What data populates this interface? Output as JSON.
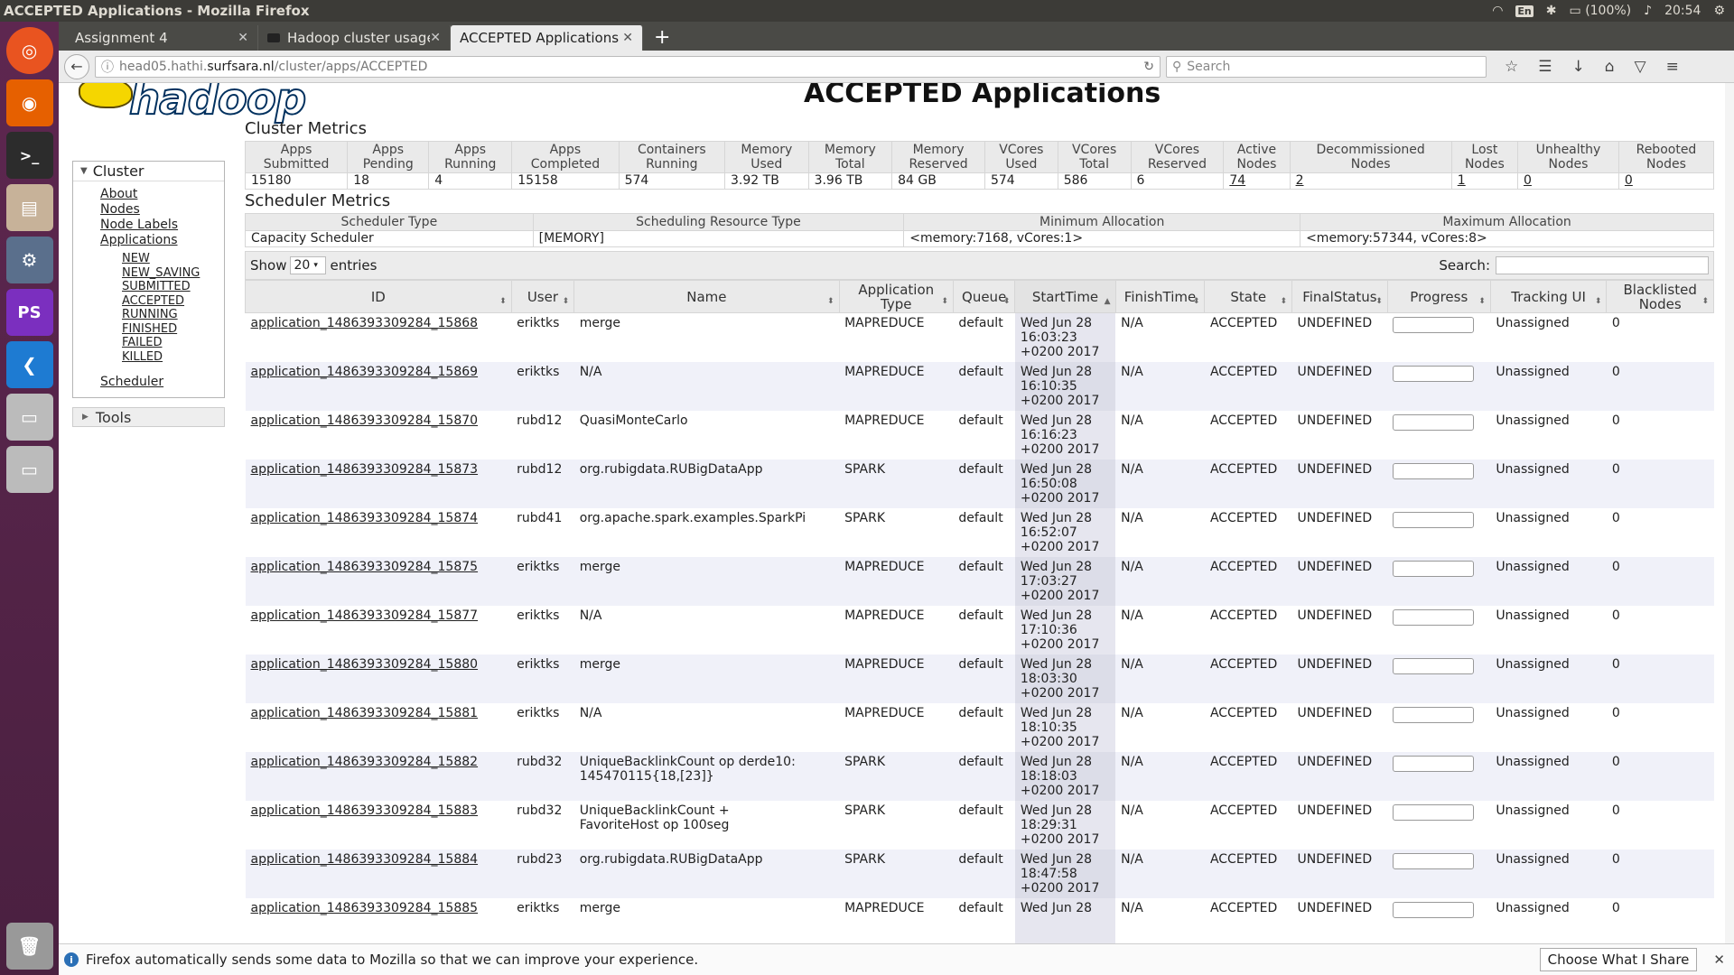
{
  "window_title": "ACCEPTED Applications - Mozilla Firefox",
  "tray": {
    "kbd": "En",
    "battery": "(100%)",
    "time": "20:54"
  },
  "tabs": [
    {
      "label": "Assignment 4"
    },
    {
      "label": "Hadoop cluster usage"
    },
    {
      "label": "ACCEPTED Applications"
    }
  ],
  "url": {
    "prefix": "head05.hathi.",
    "host": "surfsara.nl",
    "path": "/cluster/apps/ACCEPTED"
  },
  "search_placeholder": "Search",
  "page": {
    "logo": "hadoop",
    "title": "ACCEPTED Applications"
  },
  "nav": {
    "cluster": "Cluster",
    "about": "About",
    "nodes": "Nodes",
    "node_labels": "Node Labels",
    "applications": "Applications",
    "states": [
      "NEW",
      "NEW_SAVING",
      "SUBMITTED",
      "ACCEPTED",
      "RUNNING",
      "FINISHED",
      "FAILED",
      "KILLED"
    ],
    "scheduler": "Scheduler",
    "tools": "Tools"
  },
  "cluster_metrics": {
    "title": "Cluster Metrics",
    "headers": [
      [
        "Apps",
        "Submitted"
      ],
      [
        "Apps",
        "Pending"
      ],
      [
        "Apps",
        "Running"
      ],
      [
        "Apps",
        "Completed"
      ],
      [
        "Containers",
        "Running"
      ],
      [
        "Memory",
        "Used"
      ],
      [
        "Memory",
        "Total"
      ],
      [
        "Memory",
        "Reserved"
      ],
      [
        "VCores",
        "Used"
      ],
      [
        "VCores",
        "Total"
      ],
      [
        "VCores",
        "Reserved"
      ],
      [
        "Active",
        "Nodes"
      ],
      [
        "Decommissioned",
        "Nodes"
      ],
      [
        "Lost",
        "Nodes"
      ],
      [
        "Unhealthy",
        "Nodes"
      ],
      [
        "Rebooted",
        "Nodes"
      ]
    ],
    "values": [
      "15180",
      "18",
      "4",
      "15158",
      "574",
      "3.92 TB",
      "3.96 TB",
      "84 GB",
      "574",
      "586",
      "6",
      "74",
      "2",
      "1",
      "0",
      "0"
    ]
  },
  "scheduler_metrics": {
    "title": "Scheduler Metrics",
    "headers": [
      "Scheduler Type",
      "Scheduling Resource Type",
      "Minimum Allocation",
      "Maximum Allocation"
    ],
    "values": [
      "Capacity Scheduler",
      "[MEMORY]",
      "<memory:7168, vCores:1>",
      "<memory:57344, vCores:8>"
    ]
  },
  "controls": {
    "show": "Show",
    "entries_value": "20",
    "entries": "entries",
    "search": "Search:"
  },
  "apps_table": {
    "headers": [
      "ID",
      "User",
      "Name",
      "Application Type",
      "Queue",
      "StartTime",
      "FinishTime",
      "State",
      "FinalStatus",
      "Progress",
      "Tracking UI",
      "Blacklisted Nodes"
    ],
    "rows": [
      {
        "id": "application_1486393309284_15868",
        "user": "eriktks",
        "name": "merge",
        "type": "MAPREDUCE",
        "queue": "default",
        "start1": "Wed Jun 28",
        "start2": "16:03:23",
        "start3": "+0200 2017",
        "finish": "N/A",
        "state": "ACCEPTED",
        "final": "UNDEFINED",
        "tracking": "Unassigned",
        "blacklisted": "0"
      },
      {
        "id": "application_1486393309284_15869",
        "user": "eriktks",
        "name": "N/A",
        "type": "MAPREDUCE",
        "queue": "default",
        "start1": "Wed Jun 28",
        "start2": "16:10:35",
        "start3": "+0200 2017",
        "finish": "N/A",
        "state": "ACCEPTED",
        "final": "UNDEFINED",
        "tracking": "Unassigned",
        "blacklisted": "0"
      },
      {
        "id": "application_1486393309284_15870",
        "user": "rubd12",
        "name": "QuasiMonteCarlo",
        "type": "MAPREDUCE",
        "queue": "default",
        "start1": "Wed Jun 28",
        "start2": "16:16:23",
        "start3": "+0200 2017",
        "finish": "N/A",
        "state": "ACCEPTED",
        "final": "UNDEFINED",
        "tracking": "Unassigned",
        "blacklisted": "0"
      },
      {
        "id": "application_1486393309284_15873",
        "user": "rubd12",
        "name": "org.rubigdata.RUBigDataApp",
        "type": "SPARK",
        "queue": "default",
        "start1": "Wed Jun 28",
        "start2": "16:50:08",
        "start3": "+0200 2017",
        "finish": "N/A",
        "state": "ACCEPTED",
        "final": "UNDEFINED",
        "tracking": "Unassigned",
        "blacklisted": "0"
      },
      {
        "id": "application_1486393309284_15874",
        "user": "rubd41",
        "name": "org.apache.spark.examples.SparkPi",
        "type": "SPARK",
        "queue": "default",
        "start1": "Wed Jun 28",
        "start2": "16:52:07",
        "start3": "+0200 2017",
        "finish": "N/A",
        "state": "ACCEPTED",
        "final": "UNDEFINED",
        "tracking": "Unassigned",
        "blacklisted": "0"
      },
      {
        "id": "application_1486393309284_15875",
        "user": "eriktks",
        "name": "merge",
        "type": "MAPREDUCE",
        "queue": "default",
        "start1": "Wed Jun 28",
        "start2": "17:03:27",
        "start3": "+0200 2017",
        "finish": "N/A",
        "state": "ACCEPTED",
        "final": "UNDEFINED",
        "tracking": "Unassigned",
        "blacklisted": "0"
      },
      {
        "id": "application_1486393309284_15877",
        "user": "eriktks",
        "name": "N/A",
        "type": "MAPREDUCE",
        "queue": "default",
        "start1": "Wed Jun 28",
        "start2": "17:10:36",
        "start3": "+0200 2017",
        "finish": "N/A",
        "state": "ACCEPTED",
        "final": "UNDEFINED",
        "tracking": "Unassigned",
        "blacklisted": "0"
      },
      {
        "id": "application_1486393309284_15880",
        "user": "eriktks",
        "name": "merge",
        "type": "MAPREDUCE",
        "queue": "default",
        "start1": "Wed Jun 28",
        "start2": "18:03:30",
        "start3": "+0200 2017",
        "finish": "N/A",
        "state": "ACCEPTED",
        "final": "UNDEFINED",
        "tracking": "Unassigned",
        "blacklisted": "0"
      },
      {
        "id": "application_1486393309284_15881",
        "user": "eriktks",
        "name": "N/A",
        "type": "MAPREDUCE",
        "queue": "default",
        "start1": "Wed Jun 28",
        "start2": "18:10:35",
        "start3": "+0200 2017",
        "finish": "N/A",
        "state": "ACCEPTED",
        "final": "UNDEFINED",
        "tracking": "Unassigned",
        "blacklisted": "0"
      },
      {
        "id": "application_1486393309284_15882",
        "user": "rubd32",
        "name": "UniqueBacklinkCount op derde10:",
        "name2": "145470115{18,[23]}",
        "type": "SPARK",
        "queue": "default",
        "start1": "Wed Jun 28",
        "start2": "18:18:03",
        "start3": "+0200 2017",
        "finish": "N/A",
        "state": "ACCEPTED",
        "final": "UNDEFINED",
        "tracking": "Unassigned",
        "blacklisted": "0"
      },
      {
        "id": "application_1486393309284_15883",
        "user": "rubd32",
        "name": "UniqueBacklinkCount +",
        "name2": "FavoriteHost op 100seg",
        "type": "SPARK",
        "queue": "default",
        "start1": "Wed Jun 28",
        "start2": "18:29:31",
        "start3": "+0200 2017",
        "finish": "N/A",
        "state": "ACCEPTED",
        "final": "UNDEFINED",
        "tracking": "Unassigned",
        "blacklisted": "0"
      },
      {
        "id": "application_1486393309284_15884",
        "user": "rubd23",
        "name": "org.rubigdata.RUBigDataApp",
        "type": "SPARK",
        "queue": "default",
        "start1": "Wed Jun 28",
        "start2": "18:47:58",
        "start3": "+0200 2017",
        "finish": "N/A",
        "state": "ACCEPTED",
        "final": "UNDEFINED",
        "tracking": "Unassigned",
        "blacklisted": "0"
      },
      {
        "id": "application_1486393309284_15885",
        "user": "eriktks",
        "name": "merge",
        "type": "MAPREDUCE",
        "queue": "default",
        "start1": "Wed Jun 28",
        "start2": "",
        "start3": "",
        "finish": "N/A",
        "state": "ACCEPTED",
        "final": "UNDEFINED",
        "tracking": "Unassigned",
        "blacklisted": "0"
      }
    ]
  },
  "notice": {
    "text": "Firefox automatically sends some data to Mozilla so that we can improve your experience.",
    "button": "Choose What I Share"
  }
}
